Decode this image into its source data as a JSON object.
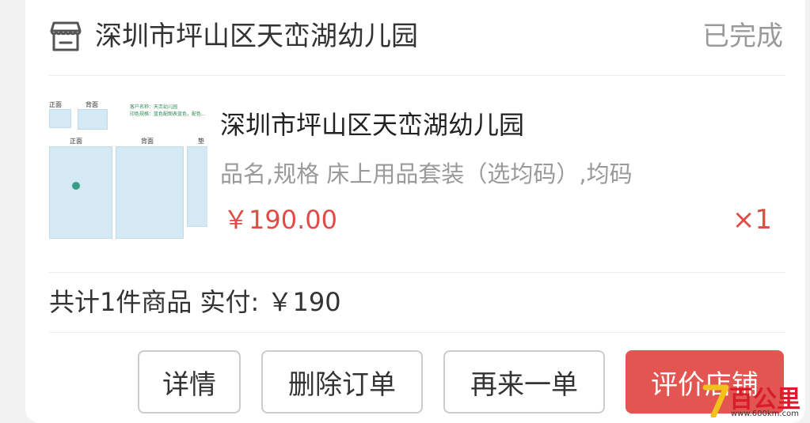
{
  "shop": {
    "name": "深圳市坪山区天峦湖幼儿园",
    "status": "已完成"
  },
  "product": {
    "thumbnail": {
      "label_front_small": "正面",
      "label_back_small": "背面",
      "label_front": "正面",
      "label_back": "背面",
      "label_extra": "垫",
      "info_line1": "客户名称：天峦幼儿园",
      "info_line2": "印色规格：蓝色配图表蓝色，配色..."
    },
    "name": "深圳市坪山区天峦湖幼儿园",
    "spec": "品名,规格 床上用品套装（选均码）,均码",
    "price": "￥190.00",
    "quantity": "×1"
  },
  "summary": {
    "text": "共计1件商品 实付: ￥190"
  },
  "actions": {
    "details": "详情",
    "delete_order": "删除订单",
    "reorder": "再来一单",
    "review_shop": "评价店铺"
  },
  "watermark": {
    "text": "百公里",
    "url": "www.600km.com"
  },
  "colors": {
    "accent": "#e14a45",
    "button_primary": "#e35550",
    "status_gray": "#9a9a9a"
  }
}
